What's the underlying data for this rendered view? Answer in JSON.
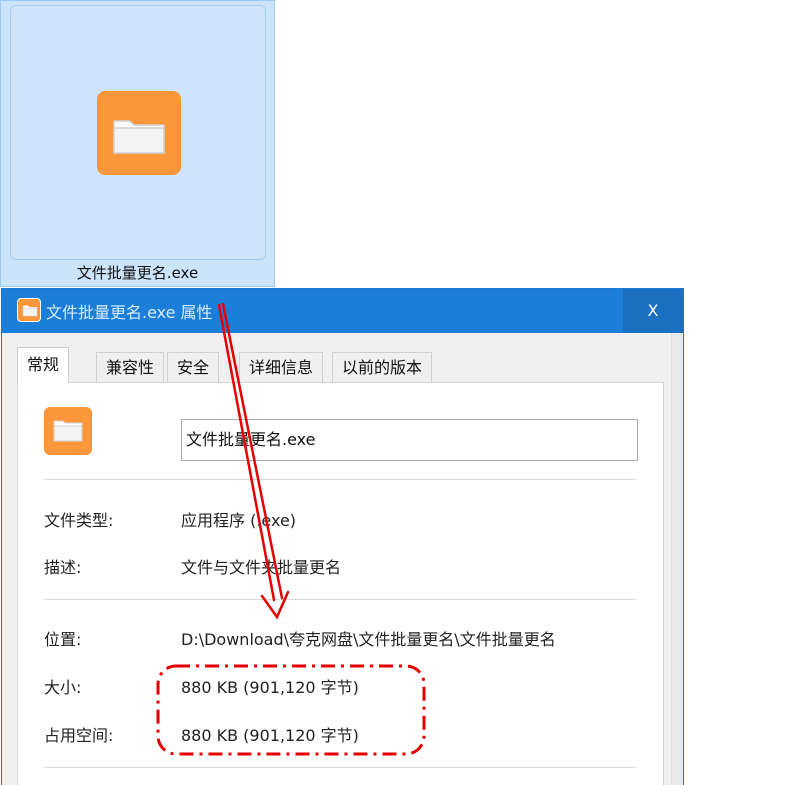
{
  "desktop_file": {
    "name": "文件批量更名.exe",
    "icon": "folder-icon"
  },
  "dialog": {
    "title": "文件批量更名.exe 属性",
    "close_label": "X",
    "tabs": [
      {
        "label": "常规",
        "active": true
      },
      {
        "label": "兼容性",
        "active": false
      },
      {
        "label": "安全",
        "active": false
      },
      {
        "label": "详细信息",
        "active": false
      },
      {
        "label": "以前的版本",
        "active": false
      }
    ],
    "general": {
      "file_name": "文件批量更名.exe",
      "file_type_label": "文件类型:",
      "file_type_value": "应用程序 (.exe)",
      "description_label": "描述:",
      "description_value": "文件与文件夹批量更名",
      "location_label": "位置:",
      "location_value": "D:\\Download\\夸克网盘\\文件批量更名\\文件批量更名",
      "size_label": "大小:",
      "size_value": "880 KB (901,120 字节)",
      "size_on_disk_label": "占用空间:",
      "size_on_disk_value": "880 KB (901,120 字节)"
    }
  },
  "colors": {
    "accent": "#1b7ed8",
    "app_icon": "#fb973a",
    "annotation": "#e60000",
    "selection": "#cce4fa"
  }
}
